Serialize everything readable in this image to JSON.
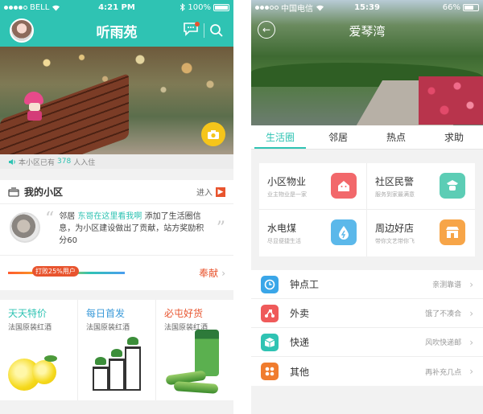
{
  "left": {
    "status": {
      "carrier": "BELL",
      "time": "4:21 PM",
      "battery": "100%"
    },
    "nav": {
      "title": "听雨苑"
    },
    "resident_bar": {
      "prefix": "本小区已有",
      "count": "378",
      "suffix": "人入住"
    },
    "my_community": {
      "title": "我的小区",
      "enter_label": "进入",
      "news": {
        "prefix": "邻居",
        "user": "东哥在这里看我啊",
        "text": "添加了生活圈信息，为小区建设做出了贡献，站方奖励积分60"
      },
      "progress": {
        "badge": "打败25%用户",
        "value": 0.25
      },
      "contribute_label": "奉献"
    },
    "promos": [
      {
        "title": "天天特价",
        "subtitle": "法国原装红酒",
        "color": "#2fc3b3"
      },
      {
        "title": "每日首发",
        "subtitle": "法国原装红酒",
        "color": "#3a9ad9"
      },
      {
        "title": "必屯好货",
        "subtitle": "法国原装红酒",
        "color": "#e8542e"
      }
    ]
  },
  "right": {
    "status": {
      "carrier": "中国电信",
      "time": "15:39",
      "battery": "66%"
    },
    "title": "爱琴湾",
    "tabs": [
      "生活圈",
      "邻居",
      "热点",
      "求助"
    ],
    "services": [
      {
        "title": "小区物业",
        "subtitle": "业主物业是一家",
        "icon": "house-icon",
        "color": "#f2686b"
      },
      {
        "title": "社区民警",
        "subtitle": "服务到家最满意",
        "icon": "police-icon",
        "color": "#5ccdb5"
      },
      {
        "title": "水电煤",
        "subtitle": "尽显便捷生活",
        "icon": "water-drop-icon",
        "color": "#5bb8ea"
      },
      {
        "title": "周边好店",
        "subtitle": "带你文艺带你飞",
        "icon": "shop-icon",
        "color": "#f7a548"
      }
    ],
    "list": [
      {
        "label": "钟点工",
        "desc": "亲测靠谱",
        "icon": "clock-icon",
        "color": "#3aa6e8"
      },
      {
        "label": "外卖",
        "desc": "饿了不凑合",
        "icon": "scooter-icon",
        "color": "#ef5a5a"
      },
      {
        "label": "快递",
        "desc": "风吹快递邮",
        "icon": "package-icon",
        "color": "#2fc3b3"
      },
      {
        "label": "其他",
        "desc": "再补充几点",
        "icon": "grid-icon",
        "color": "#f07c2e"
      }
    ]
  }
}
